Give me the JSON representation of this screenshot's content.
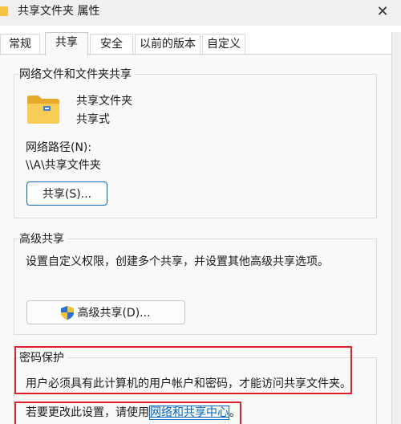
{
  "window": {
    "title": "共享文件夹 属性",
    "close_symbol": "✕"
  },
  "tabs": [
    {
      "label": "常规",
      "active": false
    },
    {
      "label": "共享",
      "active": true
    },
    {
      "label": "安全",
      "active": false
    },
    {
      "label": "以前的版本",
      "active": false
    },
    {
      "label": "自定义",
      "active": false
    }
  ],
  "network_sharing": {
    "group_title": "网络文件和文件夹共享",
    "folder_name": "共享文件夹",
    "share_state": "共享式",
    "path_label": "网络路径(N):",
    "path_value": "\\\\A\\共享文件夹",
    "share_button": "共享(S)..."
  },
  "advanced_sharing": {
    "group_title": "高级共享",
    "description": "设置自定义权限，创建多个共享，并设置其他高级共享选项。",
    "button": "高级共享(D)..."
  },
  "password_protection": {
    "group_title": "密码保护",
    "description": "用户必须具有此计算机的用户帐户和密码，才能访问共享文件夹。",
    "change_prefix": "若要更改此设置，请使用",
    "change_link": "网络和共享中心",
    "change_suffix": "。"
  },
  "colors": {
    "accent": "#0067c0",
    "highlight_box": "#e0202a",
    "folder_yellow": "#f5c242"
  },
  "icons": {
    "title": "folder-icon",
    "big_folder": "shared-folder-icon",
    "advanced_button": "uac-shield-icon",
    "close": "close-icon"
  }
}
